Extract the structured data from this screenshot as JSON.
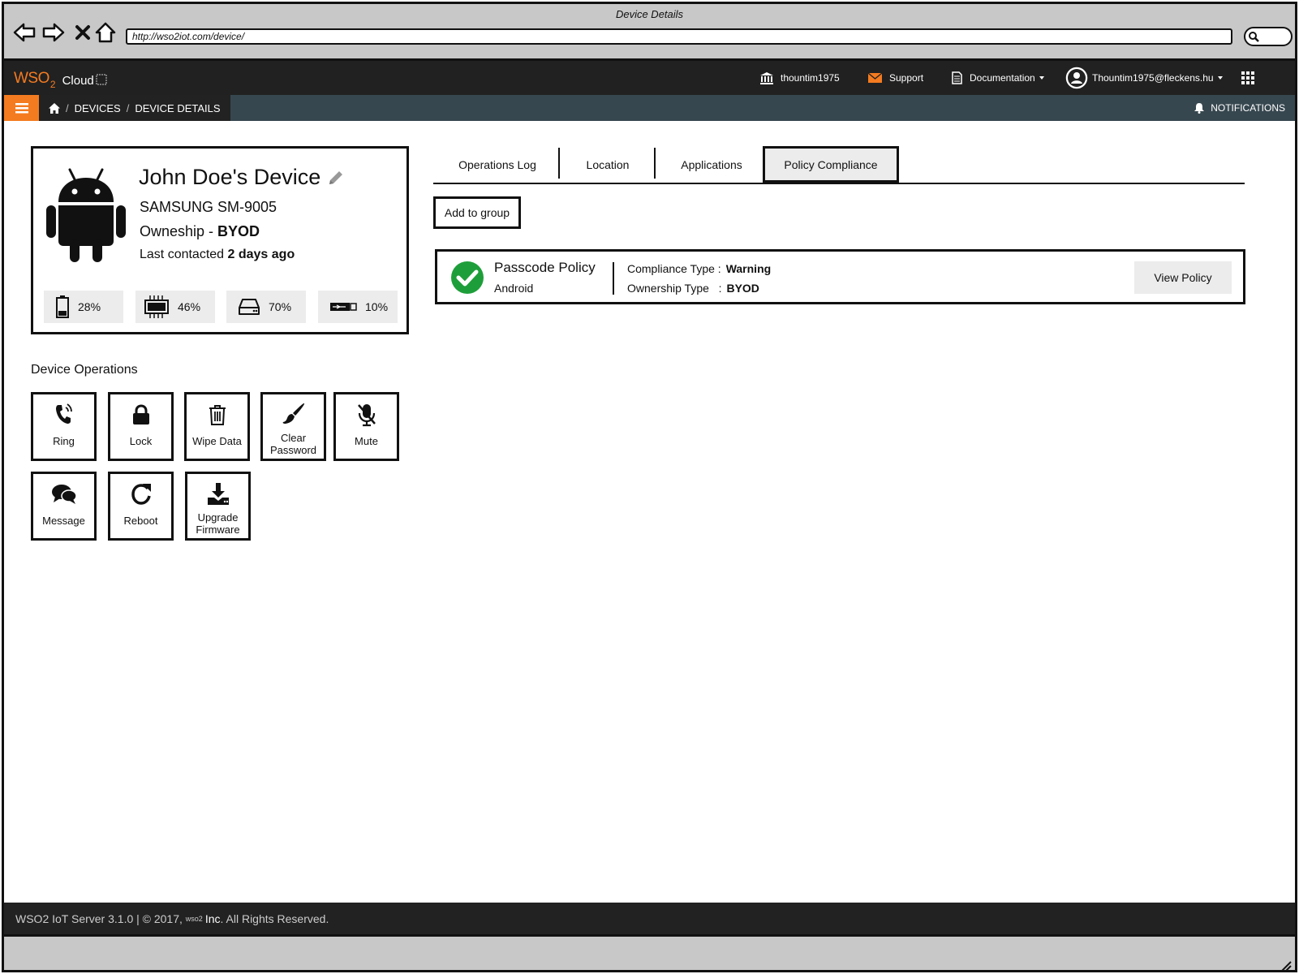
{
  "window": {
    "title": "Device Details"
  },
  "browser": {
    "url": "http://wso2iot.com/device/"
  },
  "header": {
    "logo_text": "WSO",
    "logo_sub": "2",
    "logo_product": "Cloud",
    "tenant": "thountim1975",
    "support": "Support",
    "documentation": "Documentation",
    "user": "Thountim1975@fleckens.hu"
  },
  "breadcrumb": {
    "devices": "DEVICES",
    "sep": "/",
    "current": "DEVICE DETAILS"
  },
  "notifications": "NOTIFICATIONS",
  "device": {
    "name": "John Doe's Device",
    "model": "SAMSUNG SM-9005",
    "ownership_label": "Owneship - ",
    "ownership_value": "BYOD",
    "last_contacted_label": "Last contacted ",
    "last_contacted_value": "2 days ago",
    "stats": [
      {
        "icon": "battery-icon",
        "value": "28%"
      },
      {
        "icon": "cpu-icon",
        "value": "46%"
      },
      {
        "icon": "storage-icon",
        "value": "70%"
      },
      {
        "icon": "memory-icon",
        "value": "10%"
      }
    ]
  },
  "operations": {
    "heading": "Device Operations",
    "items": [
      {
        "icon": "phone-ring-icon",
        "label": "Ring"
      },
      {
        "icon": "lock-icon",
        "label": "Lock"
      },
      {
        "icon": "trash-icon",
        "label": "Wipe Data"
      },
      {
        "icon": "brush-icon",
        "label": "Clear Password"
      },
      {
        "icon": "mic-mute-icon",
        "label": "Mute"
      },
      {
        "icon": "chat-icon",
        "label": "Message"
      },
      {
        "icon": "reboot-icon",
        "label": "Reboot"
      },
      {
        "icon": "download-icon",
        "label": "Upgrade Firmware"
      }
    ]
  },
  "tabs": [
    {
      "label": "Operations Log",
      "active": false
    },
    {
      "label": "Location",
      "active": false
    },
    {
      "label": "Applications",
      "active": false
    },
    {
      "label": "Policy Compliance",
      "active": true
    }
  ],
  "actions": {
    "add_to_group": "Add to group"
  },
  "policy": {
    "name": "Passcode Policy",
    "platform": "Android",
    "compliance_type_label": "Compliance Type :",
    "compliance_type_value": "Warning",
    "ownership_type_label": "Ownership Type   :",
    "ownership_type_value": "BYOD",
    "view_button": "View Policy",
    "status_color": "#1e9e3a"
  },
  "footer": {
    "text_before": "WSO2 IoT Server 3.1.0 | © 2017, ",
    "brand_small": "wso2",
    "brand": "Inc",
    "text_after": ". All Rights Reserved."
  },
  "colors": {
    "accent": "#f47b20",
    "topbar": "#212121",
    "subbar": "#37474f"
  }
}
